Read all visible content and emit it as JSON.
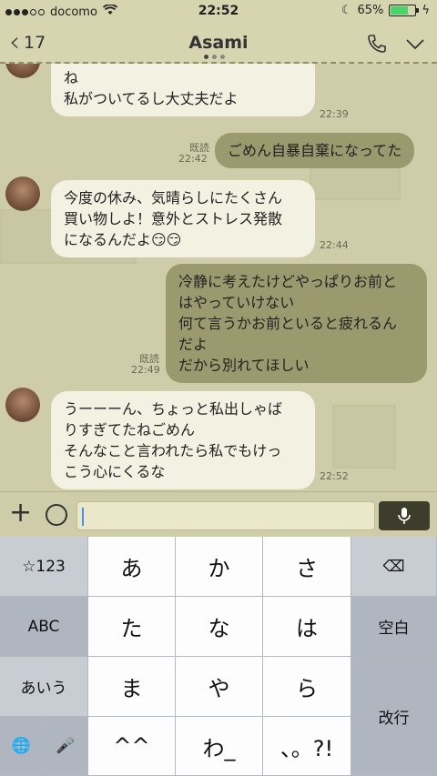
{
  "status": {
    "carrier": "docomo",
    "time": "22:52",
    "battery": "65%",
    "battery_level": 0.65
  },
  "header": {
    "back_count": "17",
    "title": "Asami"
  },
  "messages": [
    {
      "dir": "in",
      "lines": [
        "ね",
        "私がついてるし大丈夫だよ"
      ],
      "time": "22:39"
    },
    {
      "dir": "out",
      "text": "ごめん自暴自棄になってた",
      "read": "既読",
      "time": "22:42"
    },
    {
      "dir": "in",
      "lines": [
        "今度の休み、気晴らしにたくさん",
        "買い物しよ！意外とストレス発散",
        "になるんだよ😏😏"
      ],
      "time": "22:44"
    },
    {
      "dir": "out",
      "lines": [
        "冷静に考えたけどやっぱりお前と",
        "はやっていけない",
        "何て言うかお前といると疲れるん",
        "だよ",
        "だから別れてほしい"
      ],
      "read": "既読",
      "time": "22:49"
    },
    {
      "dir": "in",
      "lines": [
        "うーーーん、ちょっと私出しゃば",
        "りすぎてたねごめん",
        "そんなこと言われたら私でもけっ",
        "こう心にくるな"
      ],
      "time": "22:52"
    }
  ],
  "input": {
    "value": ""
  },
  "keyboard": {
    "row1": [
      "☆123",
      "あ",
      "か",
      "さ",
      "⌫"
    ],
    "row2": [
      "ABC",
      "た",
      "な",
      "は",
      "空白"
    ],
    "row3": [
      "あいう",
      "ま",
      "や",
      "ら",
      "改行"
    ],
    "row4": [
      "🌐",
      "🎤",
      "^^",
      "わ_",
      "、。?!"
    ]
  }
}
